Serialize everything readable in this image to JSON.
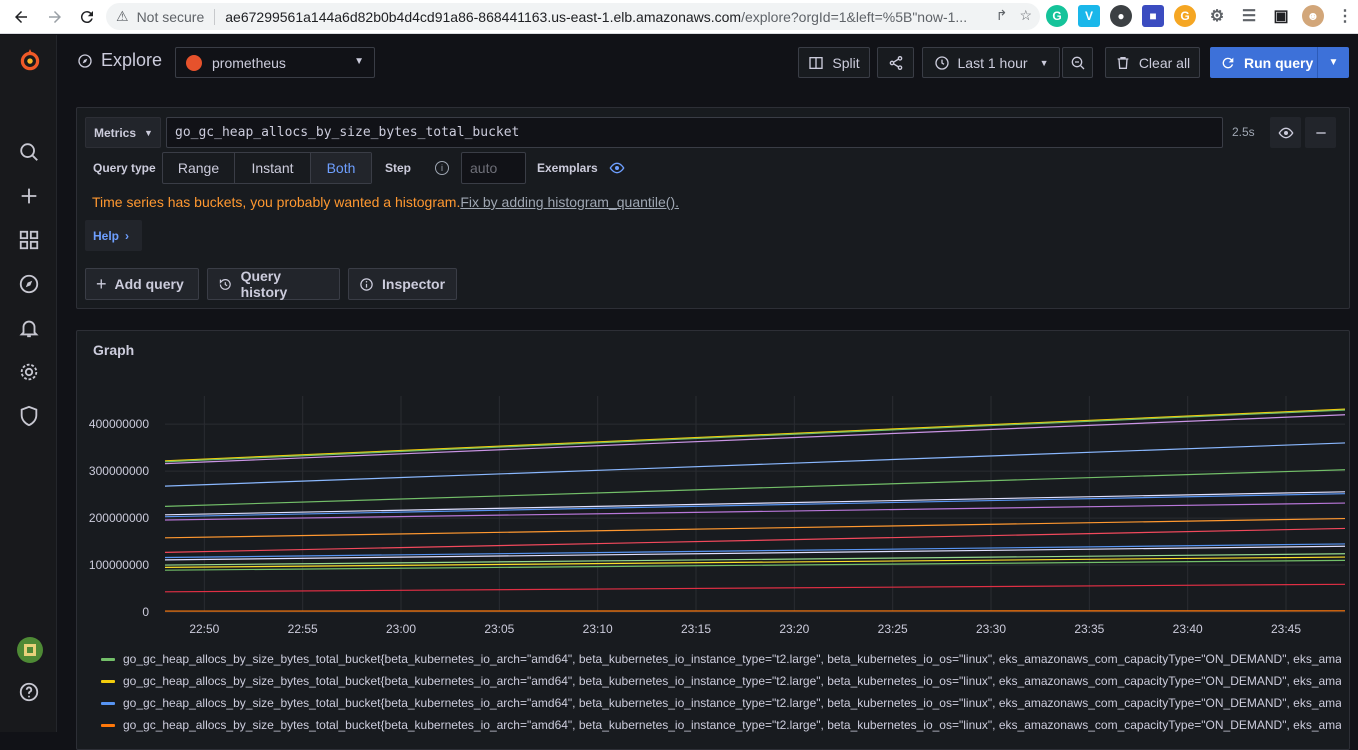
{
  "browser": {
    "security_label": "Not secure",
    "url_main": "ae67299561a144a6d82b0b4d4cd91a86-868441163.us-east-1.elb.amazonaws.com",
    "url_rest": "/explore?orgId=1&left=%5B\"now-1..."
  },
  "topbar": {
    "title": "Explore",
    "datasource": "prometheus",
    "split_label": "Split",
    "time_range": "Last 1 hour",
    "clear_label": "Clear all",
    "run_label": "Run query"
  },
  "query": {
    "metrics_label": "Metrics",
    "expression": "go_gc_heap_allocs_by_size_bytes_total_bucket",
    "duration": "2.5s",
    "query_type_label": "Query type",
    "types": [
      "Range",
      "Instant",
      "Both"
    ],
    "active_type": "Both",
    "step_label": "Step",
    "step_placeholder": "auto",
    "exemplars_label": "Exemplars",
    "warning_text": "Time series has buckets, you probably wanted a histogram.",
    "warning_fix": "Fix by adding histogram_quantile().",
    "help_label": "Help",
    "add_query_label": "Add query",
    "history_label": "Query history",
    "inspector_label": "Inspector"
  },
  "graph": {
    "title": "Graph",
    "legend": [
      {
        "color": "#73bf69",
        "label": "go_gc_heap_allocs_by_size_bytes_total_bucket{beta_kubernetes_io_arch=\"amd64\", beta_kubernetes_io_instance_type=\"t2.large\", beta_kubernetes_io_os=\"linux\", eks_amazonaws_com_capacityType=\"ON_DEMAND\", eks_amazonaw"
      },
      {
        "color": "#f2cc0c",
        "label": "go_gc_heap_allocs_by_size_bytes_total_bucket{beta_kubernetes_io_arch=\"amd64\", beta_kubernetes_io_instance_type=\"t2.large\", beta_kubernetes_io_os=\"linux\", eks_amazonaws_com_capacityType=\"ON_DEMAND\", eks_amazonaw"
      },
      {
        "color": "#5794f2",
        "label": "go_gc_heap_allocs_by_size_bytes_total_bucket{beta_kubernetes_io_arch=\"amd64\", beta_kubernetes_io_instance_type=\"t2.large\", beta_kubernetes_io_os=\"linux\", eks_amazonaws_com_capacityType=\"ON_DEMAND\", eks_amazonaw"
      },
      {
        "color": "#ff780a",
        "label": "go_gc_heap_allocs_by_size_bytes_total_bucket{beta_kubernetes_io_arch=\"amd64\", beta_kubernetes_io_instance_type=\"t2.large\", beta_kubernetes_io_os=\"linux\", eks_amazonaws_com_capacityType=\"ON_DEMAND\", eks_amazonaw"
      }
    ]
  },
  "chart_data": {
    "type": "line",
    "xlabel": "",
    "ylabel": "",
    "x": [
      "22:50",
      "22:55",
      "23:00",
      "23:05",
      "23:10",
      "23:15",
      "23:20",
      "23:25",
      "23:30",
      "23:35",
      "23:40",
      "23:45"
    ],
    "yticks": [
      0,
      100000000,
      200000000,
      300000000,
      400000000
    ],
    "ytick_labels": [
      "0",
      "100000000",
      "200000000",
      "300000000",
      "400000000"
    ],
    "ylim": [
      0,
      460000000
    ],
    "x_range": [
      "22:48",
      "23:48"
    ],
    "grid": true,
    "legend_position": "bottom",
    "series": [
      {
        "color": "#f2cc0c",
        "start": 322000000,
        "end": 432000000
      },
      {
        "color": "#73bf69",
        "start": 320000000,
        "end": 430000000
      },
      {
        "color": "#ca95e5",
        "start": 316000000,
        "end": 420000000
      },
      {
        "color": "#8ab8ff",
        "start": 268000000,
        "end": 360000000
      },
      {
        "color": "#73bf69",
        "start": 225000000,
        "end": 303000000
      },
      {
        "color": "#e0e0ff",
        "start": 207000000,
        "end": 256000000
      },
      {
        "color": "#5794f2",
        "start": 203000000,
        "end": 252000000
      },
      {
        "color": "#b877d9",
        "start": 196000000,
        "end": 232000000
      },
      {
        "color": "#ff9830",
        "start": 158000000,
        "end": 199000000
      },
      {
        "color": "#f2495c",
        "start": 127000000,
        "end": 178000000
      },
      {
        "color": "#5794f2",
        "start": 116000000,
        "end": 145000000
      },
      {
        "color": "#e0e0ff",
        "start": 111000000,
        "end": 140000000
      },
      {
        "color": "#96d98d",
        "start": 100000000,
        "end": 124000000
      },
      {
        "color": "#fade2a",
        "start": 95000000,
        "end": 117000000
      },
      {
        "color": "#73bf69",
        "start": 89000000,
        "end": 110000000
      },
      {
        "color": "#e02f44",
        "start": 43000000,
        "end": 59000000
      },
      {
        "color": "#ff780a",
        "start": 2000000,
        "end": 2500000
      }
    ]
  }
}
